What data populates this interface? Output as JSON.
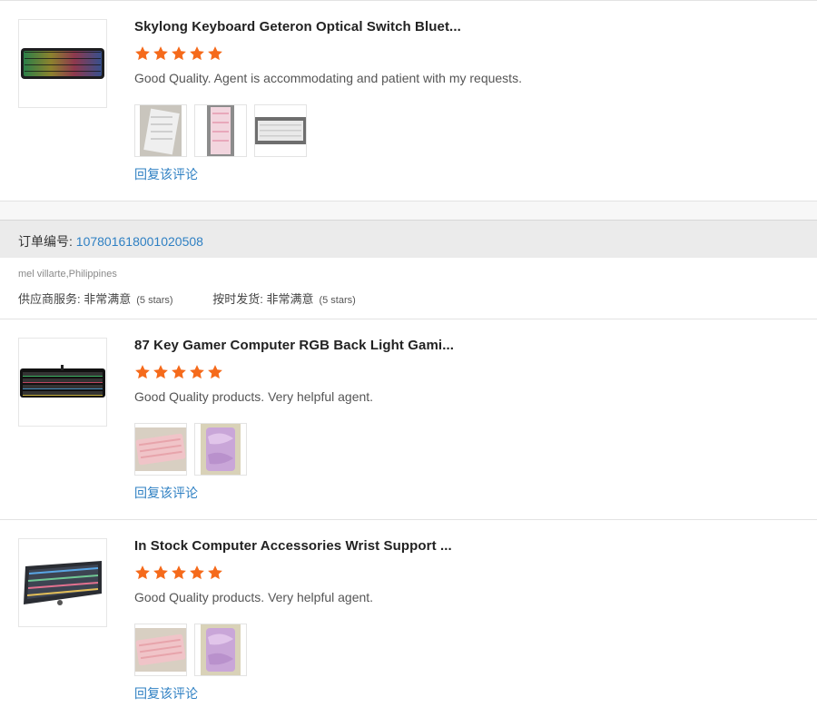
{
  "reviews": [
    {
      "product_title": "Skylong Keyboard Geteron Optical Switch Bluet...",
      "stars": 5,
      "comment": "Good Quality. Agent is accommodating and patient with my requests.",
      "reply_label": "回复该评论"
    },
    {
      "product_title": "87 Key Gamer Computer RGB Back Light Gami...",
      "stars": 5,
      "comment": "Good Quality products. Very helpful agent.",
      "reply_label": "回复该评论"
    },
    {
      "product_title": "In Stock Computer Accessories Wrist Support ...",
      "stars": 5,
      "comment": "Good Quality products. Very helpful agent.",
      "reply_label": "回复该评论"
    }
  ],
  "order": {
    "label": "订单编号: ",
    "number": "107801618001020508"
  },
  "buyer": "mel villarte,Philippines",
  "seller_ratings": [
    {
      "label": "供应商服务: ",
      "value": "非常满意",
      "stars_text": "(5 stars)"
    },
    {
      "label": "按时发货: ",
      "value": "非常满意",
      "stars_text": "(5 stars)"
    }
  ],
  "colors": {
    "star": "#f56a1b",
    "link": "#2f80c3"
  }
}
